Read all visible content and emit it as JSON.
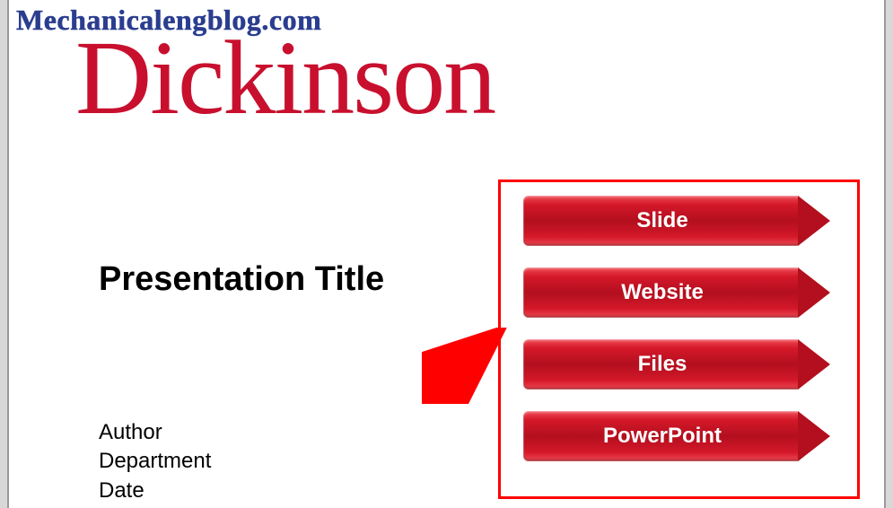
{
  "watermark": "Mechanicalengblog.com",
  "brand": "Dickinson",
  "title": "Presentation Title",
  "meta": {
    "author": "Author",
    "department": "Department",
    "date": "Date"
  },
  "buttons": [
    {
      "label": "Slide"
    },
    {
      "label": "Website"
    },
    {
      "label": "Files"
    },
    {
      "label": "PowerPoint"
    }
  ]
}
